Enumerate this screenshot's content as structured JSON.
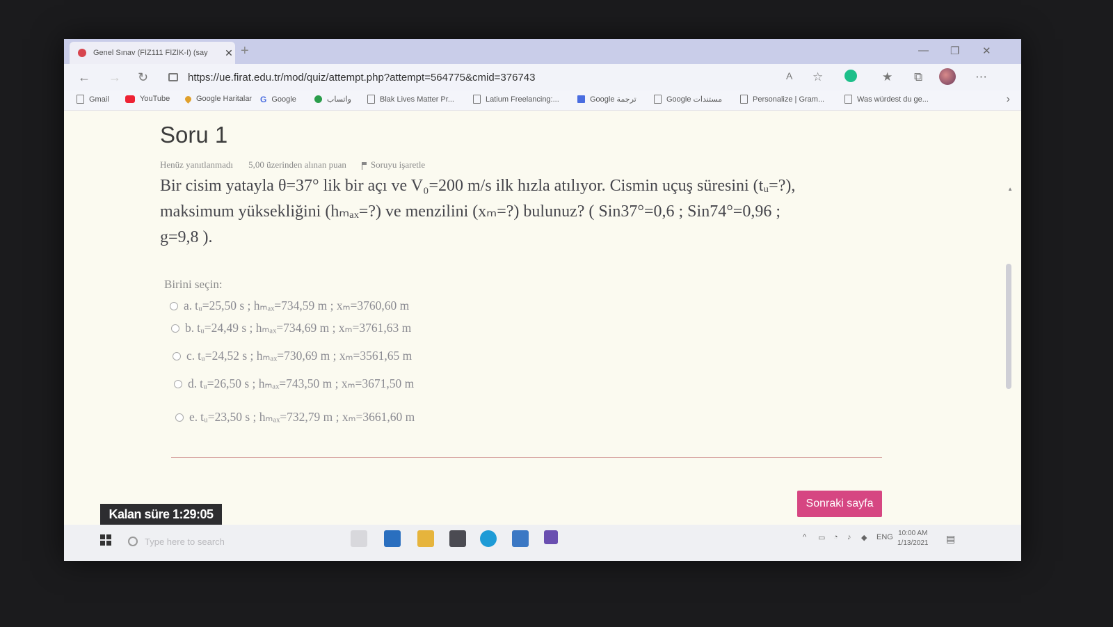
{
  "browser": {
    "tab_title": "Genel Sınav (FİZ111 FİZİK-I) (say",
    "url": "https://ue.firat.edu.tr/mod/quiz/attempt.php?attempt=564775&cmid=376743",
    "bookmarks": [
      "Gmail",
      "YouTube",
      "Google Haritalar",
      "Google",
      "واتساب",
      "Blak Lives Matter Pr...",
      "Latium Freelancing:...",
      "Google ترجمة",
      "Google مستندات",
      "Personalize | Gram...",
      "Was würdest du ge..."
    ]
  },
  "question": {
    "title": "Soru 1",
    "status": "Henüz yanıtlanmadı",
    "points": "5,00 üzerinden alınan puan",
    "flag_label": "Soruyu işaretle",
    "line1": "Bir cisim yatayla θ=37° lik bir açı ve V₀=200 m/s ilk hızla atılıyor. Cismin uçuş süresini (tᵤ=?),",
    "line2": "maksimum yüksekliğini (hₘₐₓ=?) ve menzilini (xₘ=?) bulunuz? ( Sin37°=0,6 ;   Sin74°=0,96   ;",
    "line3": "g=9,8 ).",
    "choose_label": "Birini seçin:",
    "options": [
      {
        "letter": "a.",
        "text": "tᵤ=25,50 s ; hₘₐₓ=734,59 m ; xₘ=3760,60 m"
      },
      {
        "letter": "b.",
        "text": "tᵤ=24,49 s ; hₘₐₓ=734,69 m ; xₘ=3761,63 m"
      },
      {
        "letter": "c.",
        "text": "tᵤ=24,52 s ; hₘₐₓ=730,69 m ; xₘ=3561,65 m"
      },
      {
        "letter": "d.",
        "text": "tᵤ=26,50 s ; hₘₐₓ=743,50 m ; xₘ=3671,50 m"
      },
      {
        "letter": "e.",
        "text": "tᵤ=23,50 s ; hₘₐₓ=732,79 m ; xₘ=3661,60 m"
      }
    ],
    "next_button": "Sonraki sayfa",
    "timer": "Kalan süre 1:29:05"
  },
  "taskbar": {
    "search_placeholder": "Type here to search",
    "lang": "ENG",
    "time": "10:00 AM",
    "date": "1/13/2021"
  }
}
